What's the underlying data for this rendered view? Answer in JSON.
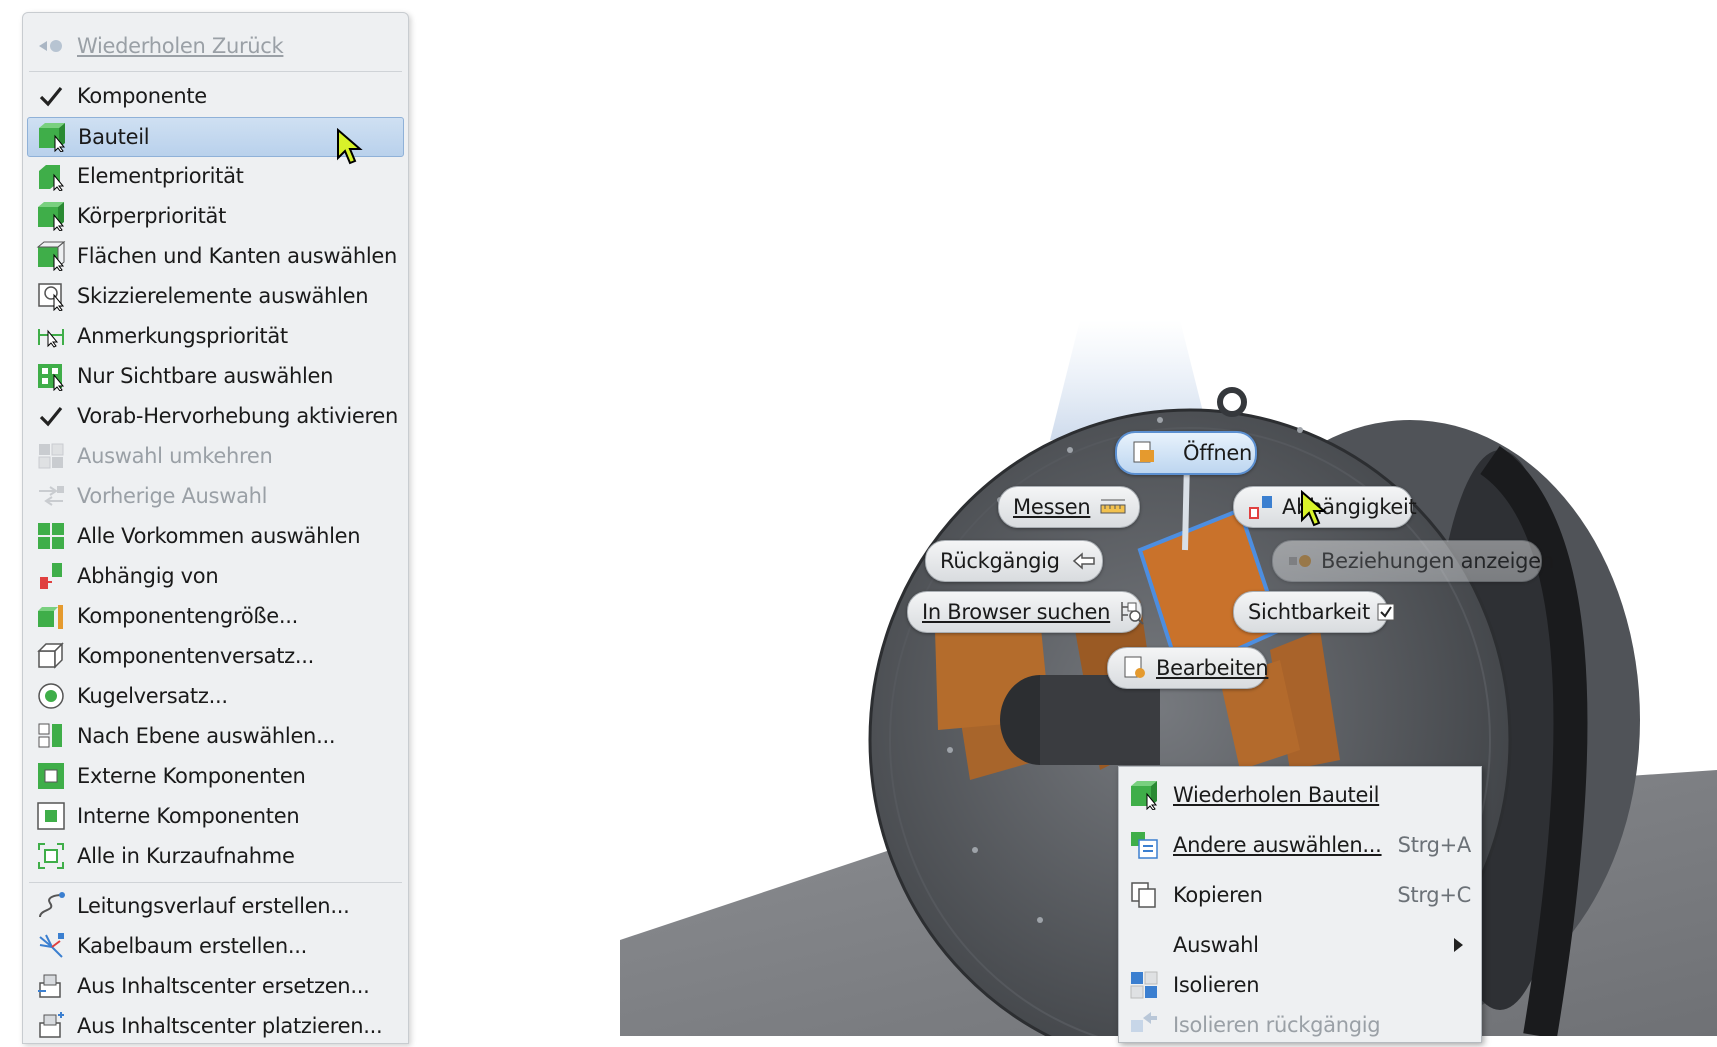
{
  "left_menu": {
    "repeat_label": "Wiederholen Zurück",
    "items": [
      {
        "label": "Komponente",
        "icon": "check-icon",
        "state": "checked"
      },
      {
        "label": "Bauteil",
        "icon": "part-icon",
        "state": "selected"
      },
      {
        "label": "Elementpriorität",
        "icon": "feature-priority-icon",
        "state": "normal"
      },
      {
        "label": "Körperpriorität",
        "icon": "body-priority-icon",
        "state": "normal"
      },
      {
        "label": "Flächen und Kanten auswählen",
        "icon": "faces-edges-icon",
        "state": "normal"
      },
      {
        "label": "Skizzierelemente auswählen",
        "icon": "sketch-select-icon",
        "state": "normal"
      },
      {
        "label": "Anmerkungspriorität",
        "icon": "annotation-priority-icon",
        "state": "normal"
      },
      {
        "label": "Nur Sichtbare auswählen",
        "icon": "visible-only-icon",
        "state": "normal"
      },
      {
        "label": "Vorab-Hervorhebung aktivieren",
        "icon": "check-icon",
        "state": "checked"
      },
      {
        "label": "Auswahl umkehren",
        "icon": "invert-selection-icon",
        "state": "disabled"
      },
      {
        "label": "Vorherige Auswahl",
        "icon": "previous-selection-icon",
        "state": "disabled"
      },
      {
        "label": "Alle Vorkommen auswählen",
        "icon": "all-occurrences-icon",
        "state": "normal"
      },
      {
        "label": "Abhängig von",
        "icon": "constrained-to-icon",
        "state": "normal"
      },
      {
        "label": "Komponentengröße...",
        "icon": "component-size-icon",
        "state": "normal"
      },
      {
        "label": "Komponentenversatz...",
        "icon": "component-offset-icon",
        "state": "normal"
      },
      {
        "label": "Kugelversatz...",
        "icon": "sphere-offset-icon",
        "state": "normal"
      },
      {
        "label": "Nach Ebene auswählen...",
        "icon": "select-by-plane-icon",
        "state": "normal"
      },
      {
        "label": "Externe Komponenten",
        "icon": "external-components-icon",
        "state": "normal"
      },
      {
        "label": "Interne Komponenten",
        "icon": "internal-components-icon",
        "state": "normal"
      },
      {
        "label": "Alle in Kurzaufnahme",
        "icon": "all-in-camera-icon",
        "state": "normal"
      }
    ],
    "items2": [
      {
        "label": "Leitungsverlauf erstellen...",
        "icon": "route-icon"
      },
      {
        "label": "Kabelbaum erstellen...",
        "icon": "harness-icon"
      },
      {
        "label": "Aus Inhaltscenter ersetzen...",
        "icon": "cc-replace-icon"
      },
      {
        "label": "Aus Inhaltscenter platzieren...",
        "icon": "cc-place-icon"
      }
    ]
  },
  "marking_menu": {
    "open": "Öffnen",
    "measure": "Messen",
    "constraint": "Abhängigkeit",
    "undo": "Rückgängig",
    "show_relations": "Beziehungen anzeigen",
    "find_in_browser": "In Browser suchen",
    "visibility": "Sichtbarkeit",
    "edit": "Bearbeiten"
  },
  "right_menu": {
    "items": [
      {
        "label": "Wiederholen Bauteil",
        "shortcut": "",
        "icon": "part-icon"
      },
      {
        "label": "Andere auswählen...",
        "shortcut": "Strg+A",
        "icon": "select-other-icon"
      },
      {
        "label": "Kopieren",
        "shortcut": "Strg+C",
        "icon": "copy-icon"
      },
      {
        "label": "Auswahl",
        "shortcut": "",
        "icon": ""
      },
      {
        "label": "Isolieren",
        "shortcut": "",
        "icon": "isolate-icon"
      },
      {
        "label": "Isolieren rückgängig",
        "shortcut": "",
        "icon": "undo-isolate-icon"
      }
    ]
  },
  "colors": {
    "selected_bg": "#c7dbf1",
    "menu_bg": "#eef0f2",
    "accent_green": "#3fae49",
    "accent_orange": "#e59a2e"
  }
}
